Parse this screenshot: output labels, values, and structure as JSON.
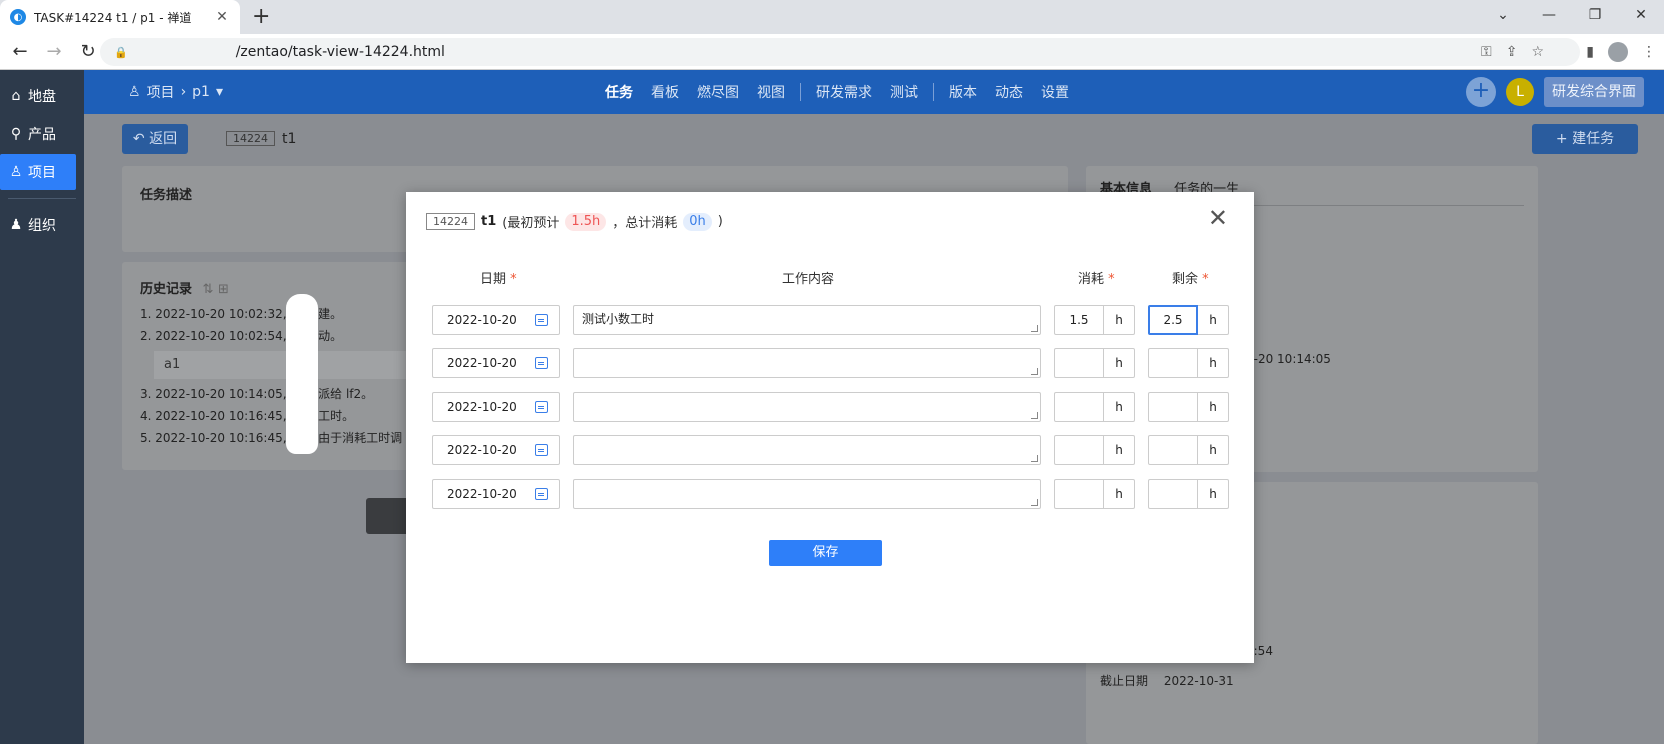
{
  "browser": {
    "tab_title": "TASK#14224 t1 / p1 - 禅道",
    "tab_close": "✕",
    "new_tab": "+",
    "url": "/zentao/task-view-14224.html"
  },
  "sidebar": {
    "items": [
      {
        "label": "地盘",
        "icon": "home-icon"
      },
      {
        "label": "产品",
        "icon": "product-icon"
      },
      {
        "label": "项目",
        "icon": "project-icon"
      },
      {
        "label": "组织",
        "icon": "user-icon"
      }
    ]
  },
  "header": {
    "crumb_root": "项目",
    "crumb_current": "p1",
    "nav": [
      "任务",
      "看板",
      "燃尽图",
      "视图",
      "研发需求",
      "测试",
      "版本",
      "动态",
      "设置"
    ],
    "avatar_letter": "L",
    "switch_label": "研发综合界面"
  },
  "page": {
    "back_label": "返回",
    "task_id": "14224",
    "task_name": "t1",
    "new_task_label": "建任务",
    "desc_title": "任务描述",
    "history_title": "历史记录",
    "history": [
      "1. 2022-10-20 10:02:32, 由 创建。",
      "2. 2022-10-20 10:02:54, 由 启动。",
      "3. 2022-10-20 10:14:05, 由 指派给 lf2。",
      "4. 2022-10-20 10:16:45, 由 除工时。",
      "5. 2022-10-20 10:16:45, 系 新由于消耗工时调"
    ],
    "history_comment": "a1",
    "basic_tab": "基本信息",
    "life_tab": "任务的一生",
    "side_time1": "0-20 10:14:05",
    "side_time2": "2:54",
    "deadline_label": "截止日期",
    "deadline_value": "2022-10-31"
  },
  "modal": {
    "task_id": "14224",
    "task_name": "t1",
    "estimate_prefix": "(最初预计",
    "estimate_value": "1.5h",
    "consumed_prefix": "，总计消耗",
    "consumed_value": "0h",
    "suffix": ")",
    "col_date": "日期",
    "col_work": "工作内容",
    "col_consumed": "消耗",
    "col_left": "剩余",
    "required_mark": "*",
    "unit": "h",
    "rows": [
      {
        "date": "2022-10-20",
        "work": "测试小数工时",
        "consumed": "1.5",
        "left": "2.5"
      },
      {
        "date": "2022-10-20",
        "work": "",
        "consumed": "",
        "left": ""
      },
      {
        "date": "2022-10-20",
        "work": "",
        "consumed": "",
        "left": ""
      },
      {
        "date": "2022-10-20",
        "work": "",
        "consumed": "",
        "left": ""
      },
      {
        "date": "2022-10-20",
        "work": "",
        "consumed": "",
        "left": ""
      }
    ],
    "save_label": "保存",
    "close_icon": "close-icon"
  },
  "colors": {
    "sidebar_bg": "#2d3a4b",
    "header_bg": "#1e5fb8",
    "primary": "#2e7ff9",
    "estimate_pill": "#fde6e6",
    "consumed_pill": "#e4eefd"
  }
}
